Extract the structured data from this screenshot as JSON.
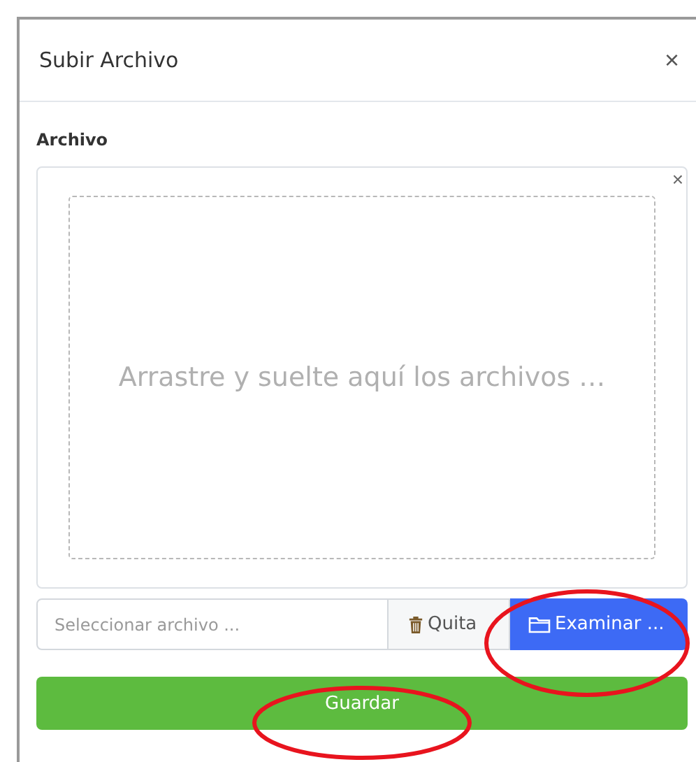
{
  "dialog": {
    "title": "Subir Archivo",
    "close": "×"
  },
  "field": {
    "label": "Archivo",
    "dropzone_close": "×",
    "drop_hint": "Arrastre y suelte aquí los archivos …"
  },
  "file_input": {
    "placeholder": "Seleccionar archivo ...",
    "remove_button": "Quita",
    "browse_button": "Examinar ...",
    "browse_circled": true
  },
  "save_button": {
    "label": "Guardar",
    "circled": true
  }
}
